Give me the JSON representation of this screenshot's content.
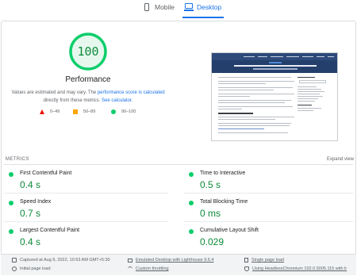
{
  "device_tabs": [
    {
      "label": "Mobile",
      "icon": "phone-icon",
      "selected": false
    },
    {
      "label": "Desktop",
      "icon": "laptop-icon",
      "selected": true
    }
  ],
  "performance": {
    "score": "100",
    "score_fraction": 1.0,
    "title": "Performance",
    "desc_part1": "Values are estimated and may vary. The ",
    "desc_link1": "performance score is calculated",
    "desc_part2": " directly from these metrics. ",
    "desc_link2": "See calculator.",
    "legend": [
      {
        "range": "0–49",
        "shape": "triangle",
        "color": "#eb0f00"
      },
      {
        "range": "50–89",
        "shape": "square",
        "color": "#ffa400"
      },
      {
        "range": "90–100",
        "shape": "circle",
        "color": "#0cce6b"
      }
    ]
  },
  "metrics": {
    "label": "METRICS",
    "expand_label": "Expand view",
    "items": [
      {
        "name": "First Contentful Paint",
        "value": "0.4 s"
      },
      {
        "name": "Time to Interactive",
        "value": "0.5 s"
      },
      {
        "name": "Speed Index",
        "value": "0.7 s"
      },
      {
        "name": "Total Blocking Time",
        "value": "0 ms"
      },
      {
        "name": "Largest Contentful Paint",
        "value": "0.4 s"
      },
      {
        "name": "Cumulative Layout Shift",
        "value": "0.029"
      }
    ]
  },
  "footer": {
    "captured": "Captured at Aug 9, 2022, 10:53 AM GMT+5:30",
    "initial_load": "Initial page load",
    "emulated": "Emulated Desktop with Lighthouse 9.6.4",
    "throttling": "Custom throttling",
    "single_load": "Single page load",
    "browser": "Using HeadlessChromium 102.0.5005.115 with lr"
  },
  "colors": {
    "accent": "#1a73e8",
    "pass": "#0cce6b",
    "pass_text": "#0d8a3a",
    "average": "#ffa400",
    "fail": "#eb0f00"
  }
}
